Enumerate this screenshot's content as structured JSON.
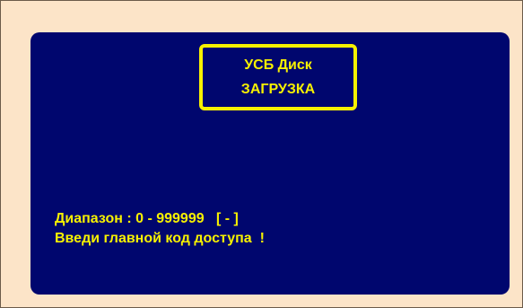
{
  "title": {
    "line1": "УСБ Диск",
    "line2": "ЗАГРУЗКА"
  },
  "prompt": {
    "range_line": "Диапазон : 0 - 999999   [ - ]",
    "instruction_line": "Введи главной код доступа  !"
  },
  "colors": {
    "background": "#fce4c8",
    "screen": "#00066e",
    "text": "#f7f100"
  }
}
